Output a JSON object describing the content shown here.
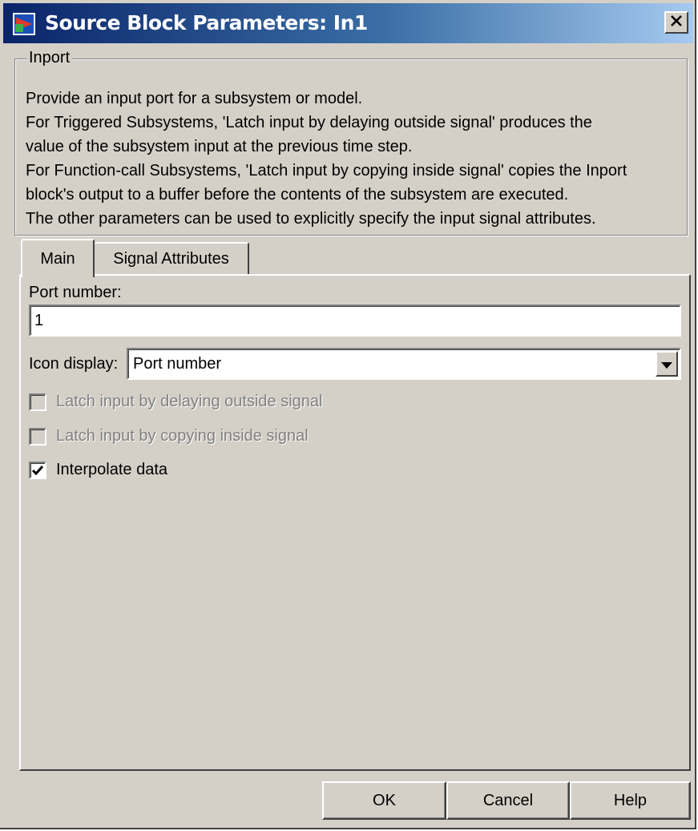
{
  "window": {
    "title": "Source Block Parameters: In1",
    "title_color": "#0a246a",
    "app_icon": "simulink-block-icon",
    "close_icon": "close-icon"
  },
  "group": {
    "legend": "Inport",
    "description": [
      "Provide an input port for a subsystem or model.",
      "For Triggered Subsystems, 'Latch input by delaying outside signal' produces the",
      "value of the subsystem input at the previous time step.",
      "For Function-call Subsystems, 'Latch input by copying inside signal' copies the Inport",
      "block's output to a buffer before the contents of the subsystem are executed.",
      "The other parameters can be used to explicitly specify the input signal attributes."
    ]
  },
  "tabs": [
    {
      "label": "Main",
      "selected": true
    },
    {
      "label": "Signal Attributes",
      "selected": false
    }
  ],
  "main": {
    "port_number_label": "Port number:",
    "port_number_value": "1",
    "icon_display_label": "Icon display:",
    "icon_display_value": "Port number",
    "checkboxes": [
      {
        "label": "Latch input by delaying outside signal",
        "checked": false,
        "enabled": false
      },
      {
        "label": "Latch input by copying inside signal",
        "checked": false,
        "enabled": false
      },
      {
        "label": "Interpolate data",
        "checked": true,
        "enabled": true
      }
    ]
  },
  "buttons": {
    "ok": "OK",
    "cancel": "Cancel",
    "help": "Help"
  }
}
